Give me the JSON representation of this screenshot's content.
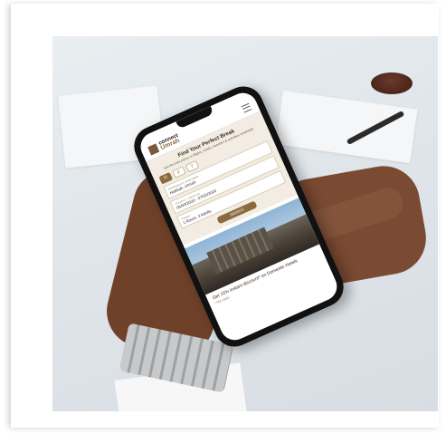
{
  "app": {
    "logo_line1": "connect",
    "logo_line2": "Umrah",
    "hero_title": "Find Your Perfect Break",
    "hero_sub": "Get the best prices on flights, hotels, transfers & activities worldwide",
    "tabs": [
      "H",
      "F",
      "T"
    ],
    "fields": [
      {
        "label": "Destination or hotel name",
        "value": "Makkah, Umrah"
      },
      {
        "label": "Check-in - Check-out",
        "value": "06/03/2020 - 07/03/2020"
      },
      {
        "label": "Rooms",
        "value": "1 Room, 2 Adults"
      }
    ],
    "search_label": "SEARCH",
    "promo_title": "Get 15% instant discount* on Domestic Hotels",
    "promo_sub": "*T&C apply"
  },
  "colors": {
    "brand": "#8a6a3f",
    "hero_bg": "#f2ece2",
    "skin": "#7a4a32"
  },
  "icons": [
    "menu-icon",
    "hotel-tab-icon",
    "flight-tab-icon",
    "transfer-tab-icon"
  ]
}
